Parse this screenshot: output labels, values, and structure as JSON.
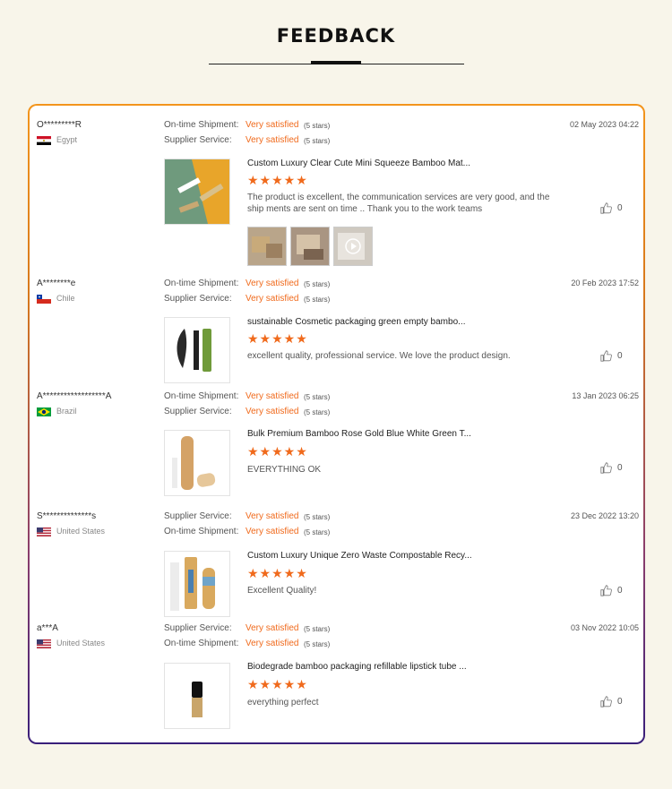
{
  "page_title": "FEEDBACK",
  "reviews": [
    {
      "reviewer": "O*********R",
      "country": "Egypt",
      "ratings": [
        {
          "label": "On-time Shipment:",
          "value": "Very satisfied",
          "stars": "(5 stars)"
        },
        {
          "label": "Supplier Service:",
          "value": "Very satisfied",
          "stars": "(5 stars)"
        }
      ],
      "date": "02 May 2023 04:22",
      "product": "Custom Luxury Clear Cute Mini Squeeze Bamboo Mat...",
      "rating_stars": "★★★★★",
      "comment": "The product is excellent, the communication services are very good, and the ship ments are sent on time .. Thank you to the work teams",
      "likes": "0"
    },
    {
      "reviewer": "A********e",
      "country": "Chile",
      "ratings": [
        {
          "label": "On-time Shipment:",
          "value": "Very satisfied",
          "stars": "(5 stars)"
        },
        {
          "label": "Supplier Service:",
          "value": "Very satisfied",
          "stars": "(5 stars)"
        }
      ],
      "date": "20 Feb 2023 17:52",
      "product": "sustainable Cosmetic packaging green empty bambo...",
      "rating_stars": "★★★★★",
      "comment": "excellent quality, professional service. We love the product design.",
      "likes": "0"
    },
    {
      "reviewer": "A******************A",
      "country": "Brazil",
      "ratings": [
        {
          "label": "On-time Shipment:",
          "value": "Very satisfied",
          "stars": "(5 stars)"
        },
        {
          "label": "Supplier Service:",
          "value": "Very satisfied",
          "stars": "(5 stars)"
        }
      ],
      "date": "13 Jan 2023 06:25",
      "product": "Bulk Premium Bamboo Rose Gold Blue White Green T...",
      "rating_stars": "★★★★★",
      "comment": "EVERYTHING OK",
      "likes": "0"
    },
    {
      "reviewer": "S**************s",
      "country": "United States",
      "ratings": [
        {
          "label": "Supplier Service:",
          "value": "Very satisfied",
          "stars": "(5 stars)"
        },
        {
          "label": "On-time Shipment:",
          "value": "Very satisfied",
          "stars": "(5 stars)"
        }
      ],
      "date": "23 Dec 2022 13:20",
      "product": "Custom Luxury Unique Zero Waste Compostable Recy...",
      "rating_stars": "★★★★★",
      "comment": "Excellent Quality!",
      "likes": "0"
    },
    {
      "reviewer": "a***A",
      "country": "United States",
      "ratings": [
        {
          "label": "Supplier Service:",
          "value": "Very satisfied",
          "stars": "(5 stars)"
        },
        {
          "label": "On-time Shipment:",
          "value": "Very satisfied",
          "stars": "(5 stars)"
        }
      ],
      "date": "03 Nov 2022 10:05",
      "product": "Biodegrade bamboo packaging refillable lipstick tube ...",
      "rating_stars": "★★★★★",
      "comment": "everything perfect",
      "likes": "0"
    }
  ],
  "icons": {
    "like": "thumbs-up-icon",
    "play": "play-icon"
  },
  "colors": {
    "accent": "#f06a1c",
    "border_top": "#f3951c",
    "border_bottom": "#3a1f7a",
    "background": "#f8f5ea"
  }
}
